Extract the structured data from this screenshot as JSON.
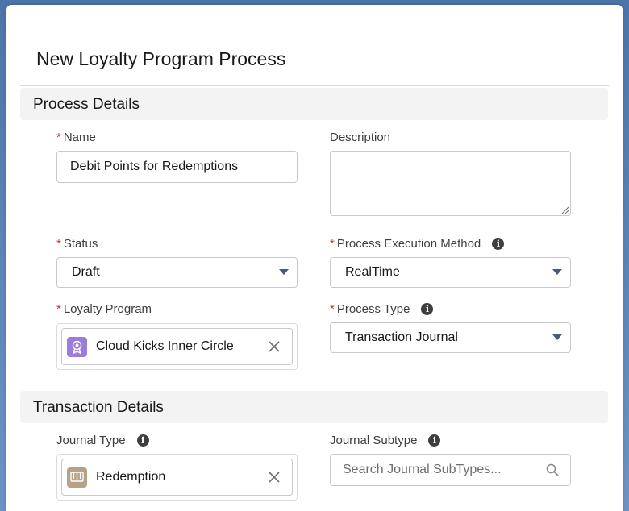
{
  "modal": {
    "title": "New Loyalty Program Process"
  },
  "process_details": {
    "heading": "Process Details",
    "name": {
      "label": "Name",
      "required": "*",
      "value": "Debit Points for Redemptions"
    },
    "description": {
      "label": "Description",
      "value": ""
    },
    "status": {
      "label": "Status",
      "required": "*",
      "value": "Draft"
    },
    "execution_method": {
      "label": "Process Execution Method",
      "required": "*",
      "value": "RealTime"
    },
    "loyalty_program": {
      "label": "Loyalty Program",
      "required": "*",
      "value": "Cloud Kicks Inner Circle",
      "icon": "loyalty-program-icon",
      "icon_color": "#9b7cdb"
    },
    "process_type": {
      "label": "Process Type",
      "required": "*",
      "value": "Transaction Journal"
    }
  },
  "transaction_details": {
    "heading": "Transaction Details",
    "journal_type": {
      "label": "Journal Type",
      "value": "Redemption",
      "icon": "journal-type-icon",
      "icon_color": "#b5a289"
    },
    "journal_subtype": {
      "label": "Journal Subtype",
      "placeholder": "Search Journal SubTypes..."
    }
  },
  "colors": {
    "required": "#c23934",
    "caret": "#495a78",
    "section_bg": "#f3f3f3"
  }
}
